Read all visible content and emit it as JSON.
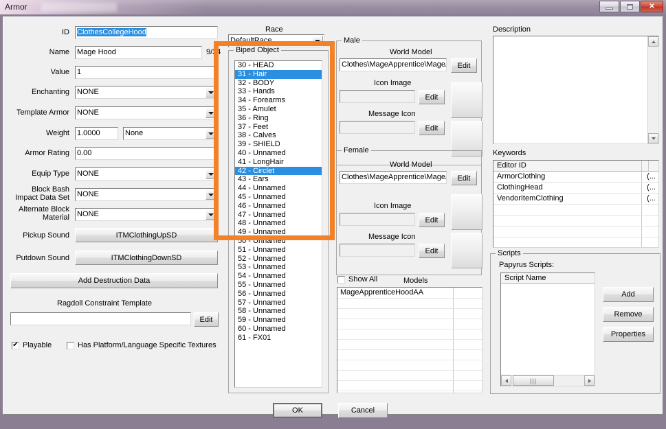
{
  "window": {
    "title": "Armor",
    "minimize_label": "minimize",
    "maximize_label": "maximize",
    "close_label": "✕"
  },
  "left_panel": {
    "id": {
      "label": "ID",
      "value": "ClothesCollegeHood"
    },
    "name": {
      "label": "Name",
      "value": "Mage Hood",
      "counter": "9/34"
    },
    "value": {
      "label": "Value",
      "value": "1"
    },
    "enchanting": {
      "label": "Enchanting",
      "value": "NONE"
    },
    "template_armor": {
      "label": "Template Armor",
      "value": "NONE"
    },
    "weight": {
      "label": "Weight",
      "value": "1.0000",
      "unit_value": "None"
    },
    "armor_rating": {
      "label": "Armor Rating",
      "value": "0.00"
    },
    "equip_type": {
      "label": "Equip Type",
      "value": "NONE"
    },
    "block_bash": {
      "label_line1": "Block Bash",
      "label_line2": "Impact Data Set",
      "value": "NONE"
    },
    "alternate_block": {
      "label_line1": "Alternate Block",
      "label_line2": "Material",
      "value": "NONE"
    },
    "pickup_sound": {
      "label": "Pickup Sound",
      "value": "ITMClothingUpSD"
    },
    "putdown_sound": {
      "label": "Putdown Sound",
      "value": "ITMClothingDownSD"
    },
    "add_destruction_data": "Add Destruction Data",
    "ragdoll": {
      "label": "Ragdoll Constraint Template",
      "value": "",
      "edit_label": "Edit"
    },
    "playable": {
      "label": "Playable",
      "checked": true,
      "glyph": "✔"
    },
    "has_platform_textures": {
      "label": "Has Platform/Language Specific Textures",
      "checked": false,
      "glyph": ""
    }
  },
  "center_panel": {
    "race": {
      "label": "Race",
      "value": "DefaultRace"
    },
    "biped_object": {
      "title": "Biped Object",
      "items": [
        {
          "text": "30 - HEAD",
          "selected": false
        },
        {
          "text": "31 - Hair",
          "selected": true
        },
        {
          "text": "32 - BODY",
          "selected": false
        },
        {
          "text": "33 - Hands",
          "selected": false
        },
        {
          "text": "34 - Forearms",
          "selected": false
        },
        {
          "text": "35 - Amulet",
          "selected": false
        },
        {
          "text": "36 - Ring",
          "selected": false
        },
        {
          "text": "37 - Feet",
          "selected": false
        },
        {
          "text": "38 - Calves",
          "selected": false
        },
        {
          "text": "39 - SHIELD",
          "selected": false
        },
        {
          "text": "40 - Unnamed",
          "selected": false
        },
        {
          "text": "41 - LongHair",
          "selected": false
        },
        {
          "text": "42 - Circlet",
          "selected": true
        },
        {
          "text": "43 - Ears",
          "selected": false
        },
        {
          "text": "44 - Unnamed",
          "selected": false
        },
        {
          "text": "45 - Unnamed",
          "selected": false
        },
        {
          "text": "46 - Unnamed",
          "selected": false
        },
        {
          "text": "47 - Unnamed",
          "selected": false
        },
        {
          "text": "48 - Unnamed",
          "selected": false
        },
        {
          "text": "49 - Unnamed",
          "selected": false
        },
        {
          "text": "50 - Unnamed",
          "selected": false
        },
        {
          "text": "51 - Unnamed",
          "selected": false
        },
        {
          "text": "52 - Unnamed",
          "selected": false
        },
        {
          "text": "53 - Unnamed",
          "selected": false
        },
        {
          "text": "54 - Unnamed",
          "selected": false
        },
        {
          "text": "55 - Unnamed",
          "selected": false
        },
        {
          "text": "56 - Unnamed",
          "selected": false
        },
        {
          "text": "57 - Unnamed",
          "selected": false
        },
        {
          "text": "58 - Unnamed",
          "selected": false
        },
        {
          "text": "59 - Unnamed",
          "selected": false
        },
        {
          "text": "60 - Unnamed",
          "selected": false
        },
        {
          "text": "61 - FX01",
          "selected": false
        }
      ]
    }
  },
  "gender_panel": {
    "male": {
      "title": "Male",
      "world_model": {
        "label": "World Model",
        "value": "Clothes\\MageApprentice\\MageA",
        "edit_label": "Edit"
      },
      "icon_image": {
        "label": "Icon Image",
        "value": "",
        "edit_label": "Edit"
      },
      "message_icon": {
        "label": "Message Icon",
        "value": "",
        "edit_label": "Edit"
      }
    },
    "female": {
      "title": "Female",
      "world_model": {
        "label": "World Model",
        "value": "Clothes\\MageApprentice\\MageA",
        "edit_label": "Edit"
      },
      "icon_image": {
        "label": "Icon Image",
        "value": "",
        "edit_label": "Edit"
      },
      "message_icon": {
        "label": "Message Icon",
        "value": "",
        "edit_label": "Edit"
      }
    },
    "show_all": {
      "label": "Show All",
      "checked": false
    },
    "models_label": "Models",
    "models": [
      "MageApprenticeHoodAA"
    ]
  },
  "right_panel": {
    "description": {
      "label": "Description",
      "value": ""
    },
    "keywords": {
      "label": "Keywords",
      "column_header": "Editor ID",
      "rows": [
        {
          "editor_id": "ArmorClothing",
          "extra": "(..."
        },
        {
          "editor_id": "ClothingHead",
          "extra": "(..."
        },
        {
          "editor_id": "VendorItemClothing",
          "extra": "(..."
        }
      ]
    },
    "scripts": {
      "title": "Scripts",
      "subtitle": "Papyrus Scripts:",
      "column_header": "Script Name",
      "rows": [],
      "add_label": "Add",
      "remove_label": "Remove",
      "properties_label": "Properties"
    }
  },
  "footer": {
    "ok_label": "OK",
    "cancel_label": "Cancel"
  },
  "annotation": {
    "highlight_color": "#f28128"
  }
}
